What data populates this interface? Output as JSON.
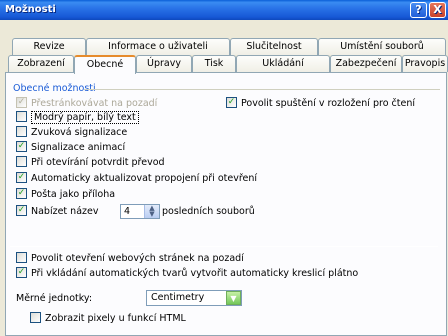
{
  "window": {
    "title": "Možnosti",
    "help_label": "?",
    "close_label": "X"
  },
  "tabs": {
    "row1": [
      "Revize",
      "Informace o uživateli",
      "Slučitelnost",
      "Umístění souborů"
    ],
    "row2": [
      "Zobrazení",
      "Obecné",
      "Úpravy",
      "Tisk",
      "Ukládání",
      "Zabezpečení",
      "Pravopis"
    ]
  },
  "section": {
    "title": "Obecné možnosti"
  },
  "options": {
    "repaginate": "Přestránkovávat na pozadí",
    "blue_paper": "Modrý papír, bílý text",
    "sound": "Zvuková signalizace",
    "animation": "Signalizace animací",
    "confirm_convert": "Při otevírání potvrdit převod",
    "update_links": "Automaticky aktualizovat propojení při otevření",
    "mail_attach": "Pošta jako příloha",
    "recent_files_prefix": "Nabízet název",
    "recent_files_value": "4",
    "recent_files_suffix": "posledních souborů",
    "allow_reading_layout": "Povolit spuštění v rozložení pro čtení",
    "web_background": "Povolit otevření webových stránek na pozadí",
    "auto_canvas": "Při vkládání automatických tvarů vytvořit automaticky kreslicí plátno",
    "units_label": "Měrné jednotky:",
    "units_value": "Centimetry",
    "html_pixels": "Zobrazit pixely u funkcí HTML"
  },
  "colors": {
    "accent": "#1a5bd6",
    "check": "#21a121",
    "active_tab": "#e68b2c"
  }
}
